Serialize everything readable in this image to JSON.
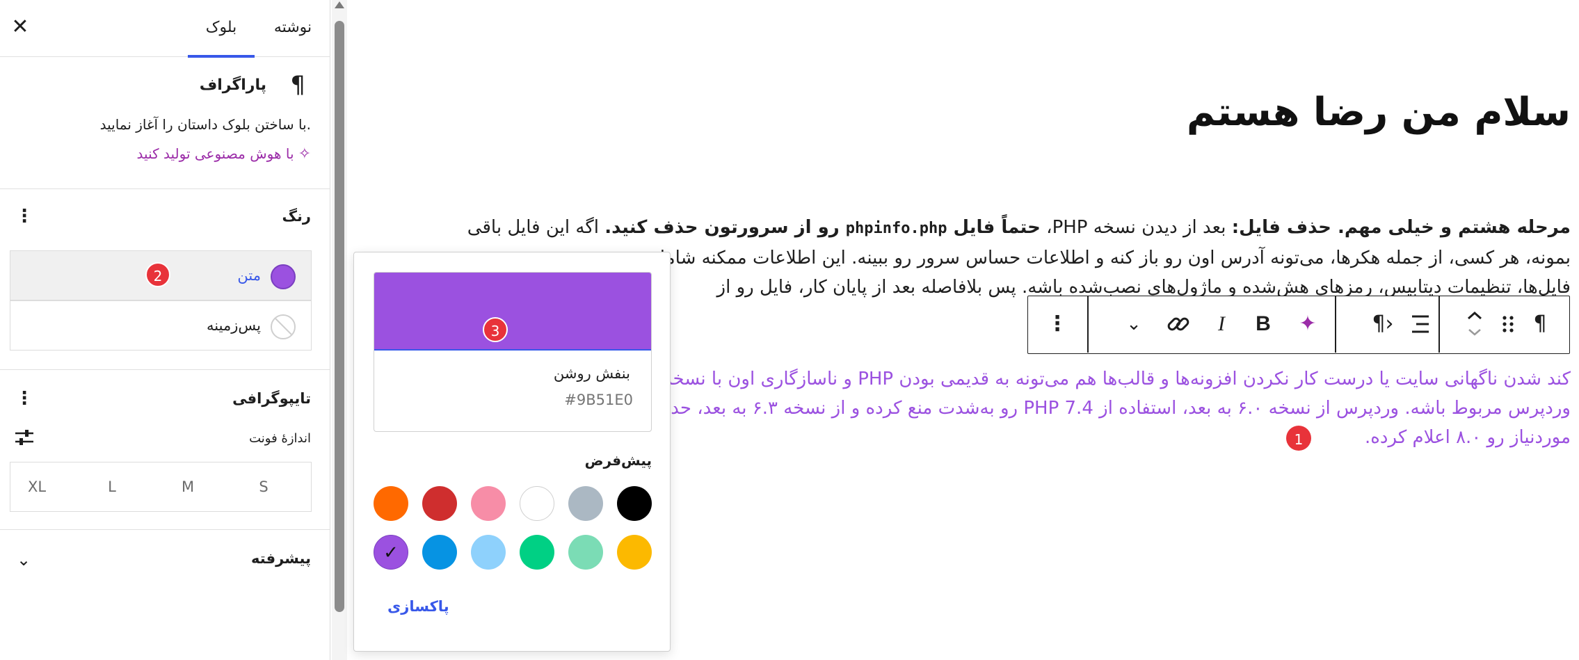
{
  "sidebar": {
    "tabs": {
      "post": "نوشته",
      "block": "بلوک"
    },
    "close_icon": "close-icon",
    "paragraph": {
      "icon": "¶",
      "title": "پاراگراف",
      "description": "با ساختن بلوک داستان را آغاز نمایید.",
      "ai_label": "با هوش مصنوعی تولید کنید"
    },
    "color": {
      "title": "رنگ",
      "items": [
        {
          "label": "متن",
          "color": "#9B51E0",
          "badge": "2"
        },
        {
          "label": "پس‌زمینه"
        }
      ]
    },
    "typography": {
      "title": "تایپوگرافی",
      "font_size_label": "اندازهٔ فونت",
      "sizes": [
        "S",
        "M",
        "L",
        "XL"
      ]
    },
    "advanced": {
      "title": "پیشرفته"
    }
  },
  "canvas": {
    "title": "سلام من رضا هستم",
    "para1": {
      "bold_intro": "مرحله هشتم و خیلی مهم. حذف فایل:",
      "text_a": " بعد از دیدن نسخه PHP، ",
      "bold_a": "حتماً فایل ",
      "code": "phpinfo.php",
      "bold_b": " رو از سرورتون حذف کنید.",
      "text_b": " اگه این فایل باقی",
      "line2": "بمونه، هر کسی، از جمله هکرها، می‌تونه آدرس اون رو باز کنه و اطلاعات حساس سرور رو ببینه. این اطلاعات ممکنه شامل",
      "line3": "فایل‌ها، تنظیمات دیتابیس، رمزهای هش‌شده و ماژول‌های نصب‌شده باشه. پس بلافاصله بعد از پایان کار، فایل رو از"
    },
    "para2": {
      "line1": "کند شدن ناگهانی سایت یا درست کار نکردن افزونه‌ها و قالب‌ها هم می‌تونه به قدیمی بودن PHP و ناسازگاری اون با نسخه",
      "line2": "وردپرس مربوط باشه. وردپرس از نسخه ۶.۰ به بعد، استفاده از PHP 7.4 رو به‌شدت منع کرده و از نسخه ۶.۳ به بعد، حداقل",
      "line3": "موردنیاز رو ۸.۰ اعلام کرده.",
      "badge": "1"
    }
  },
  "toolbar": {
    "icons": [
      "paragraph-icon",
      "drag-handle-icon",
      "move-up-down-icon",
      "align-icon",
      "text-direction-icon",
      "ai-sparkle-icon",
      "bold-icon",
      "italic-icon",
      "link-icon",
      "more-rich-text-icon",
      "options-icon"
    ],
    "bold": "B",
    "italic": "I"
  },
  "popover": {
    "selected_name": "بنفش روشن",
    "selected_hex": "#9B51E0",
    "preview_badge": "3",
    "default_label": "پیش‌فرض",
    "palette": [
      "#000000",
      "#ABB8C3",
      "#FFFFFF",
      "#F78DA7",
      "#CF2E2E",
      "#FF6900",
      "#FCB900",
      "#7BDCB5",
      "#00D084",
      "#8ED1FC",
      "#0693E3",
      "#9B51E0"
    ],
    "clear_label": "پاکسازی"
  },
  "colors": {
    "accent": "#3858e9",
    "badge": "#e8333a",
    "ai": "#9b2ca8"
  }
}
